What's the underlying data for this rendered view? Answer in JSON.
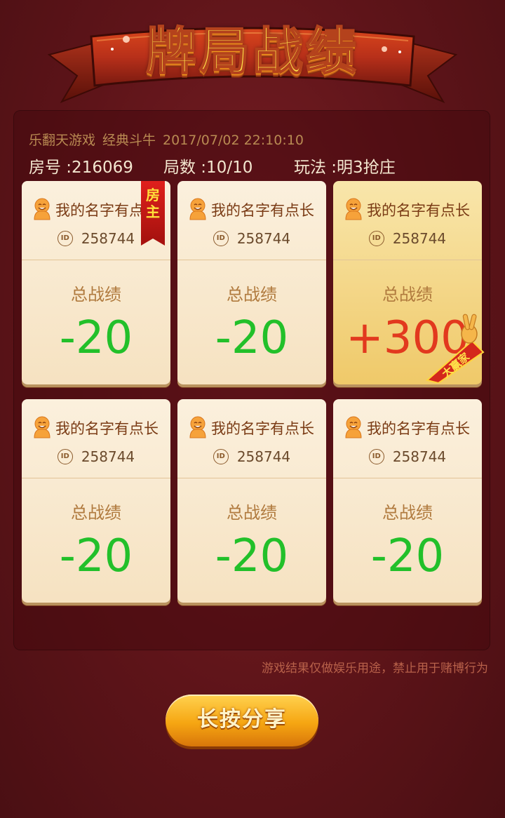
{
  "banner": {
    "title": "牌局战绩"
  },
  "info": {
    "game": "乐翻天游戏",
    "mode": "经典斗牛",
    "datetime": "2017/07/02 22:10:10",
    "room": "房号 :216069",
    "rounds": "局数 :10/10",
    "rules": "玩法 :明3抢庄"
  },
  "players": [
    {
      "name": "我的名字有点长",
      "id": "258744",
      "label": "总战绩",
      "score": "-20",
      "host": true,
      "winner": false
    },
    {
      "name": "我的名字有点长",
      "id": "258744",
      "label": "总战绩",
      "score": "-20",
      "host": false,
      "winner": false
    },
    {
      "name": "我的名字有点长",
      "id": "258744",
      "label": "总战绩",
      "score": "+300",
      "host": false,
      "winner": true
    },
    {
      "name": "我的名字有点长",
      "id": "258744",
      "label": "总战绩",
      "score": "-20",
      "host": false,
      "winner": false
    },
    {
      "name": "我的名字有点长",
      "id": "258744",
      "label": "总战绩",
      "score": "-20",
      "host": false,
      "winner": false
    },
    {
      "name": "我的名字有点长",
      "id": "258744",
      "label": "总战绩",
      "score": "-20",
      "host": false,
      "winner": false
    }
  ],
  "id_badge": "ID",
  "host_badge": "房主",
  "winner_ribbon": "大赢家",
  "disclaimer": "游戏结果仅做娱乐用途，禁止用于赌博行为",
  "share_button": "长按分享",
  "colors": {
    "background": "#5e1419",
    "loss": "#22c02a",
    "win": "#e2391e",
    "button": "#f6a612",
    "title": "#ffe24a"
  }
}
